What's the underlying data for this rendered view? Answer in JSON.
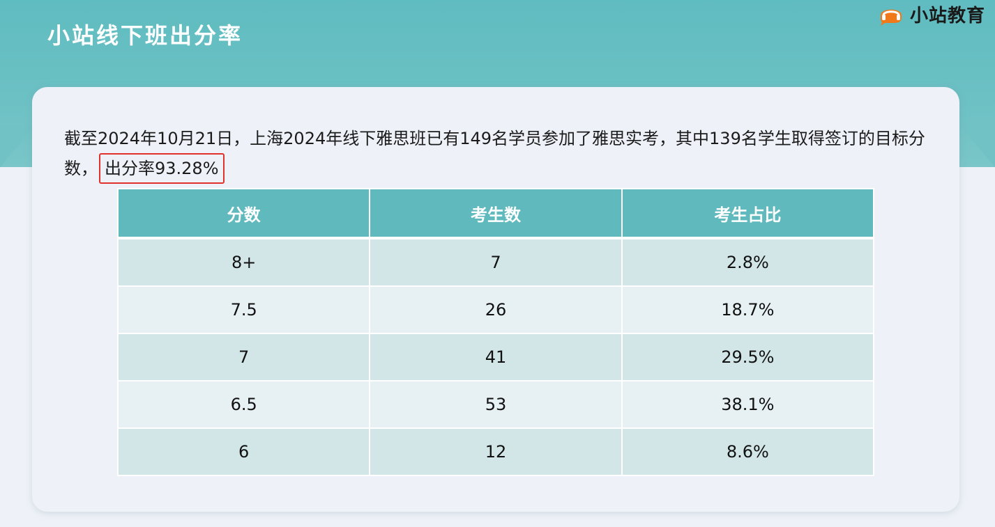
{
  "page": {
    "title": "小站线下班出分率"
  },
  "logo": {
    "text": "小站教育",
    "icon": "headset-speech-bubble-icon",
    "brand_color": "#f07a1a"
  },
  "intro": {
    "text": "截至2024年10月21日，上海2024年线下雅思班已有149名学员参加了雅思实考，其中139名学生取得签订的目标分数，",
    "highlight": "出分率93.28%",
    "highlight_color": "#e0312c"
  },
  "table": {
    "headers": [
      "分数",
      "考生数",
      "考生占比"
    ],
    "rows": [
      [
        "8+",
        "7",
        "2.8%"
      ],
      [
        "7.5",
        "26",
        "18.7%"
      ],
      [
        "7",
        "41",
        "29.5%"
      ],
      [
        "6.5",
        "53",
        "38.1%"
      ],
      [
        "6",
        "12",
        "8.6%"
      ]
    ],
    "header_color": "#5fb9bd"
  }
}
